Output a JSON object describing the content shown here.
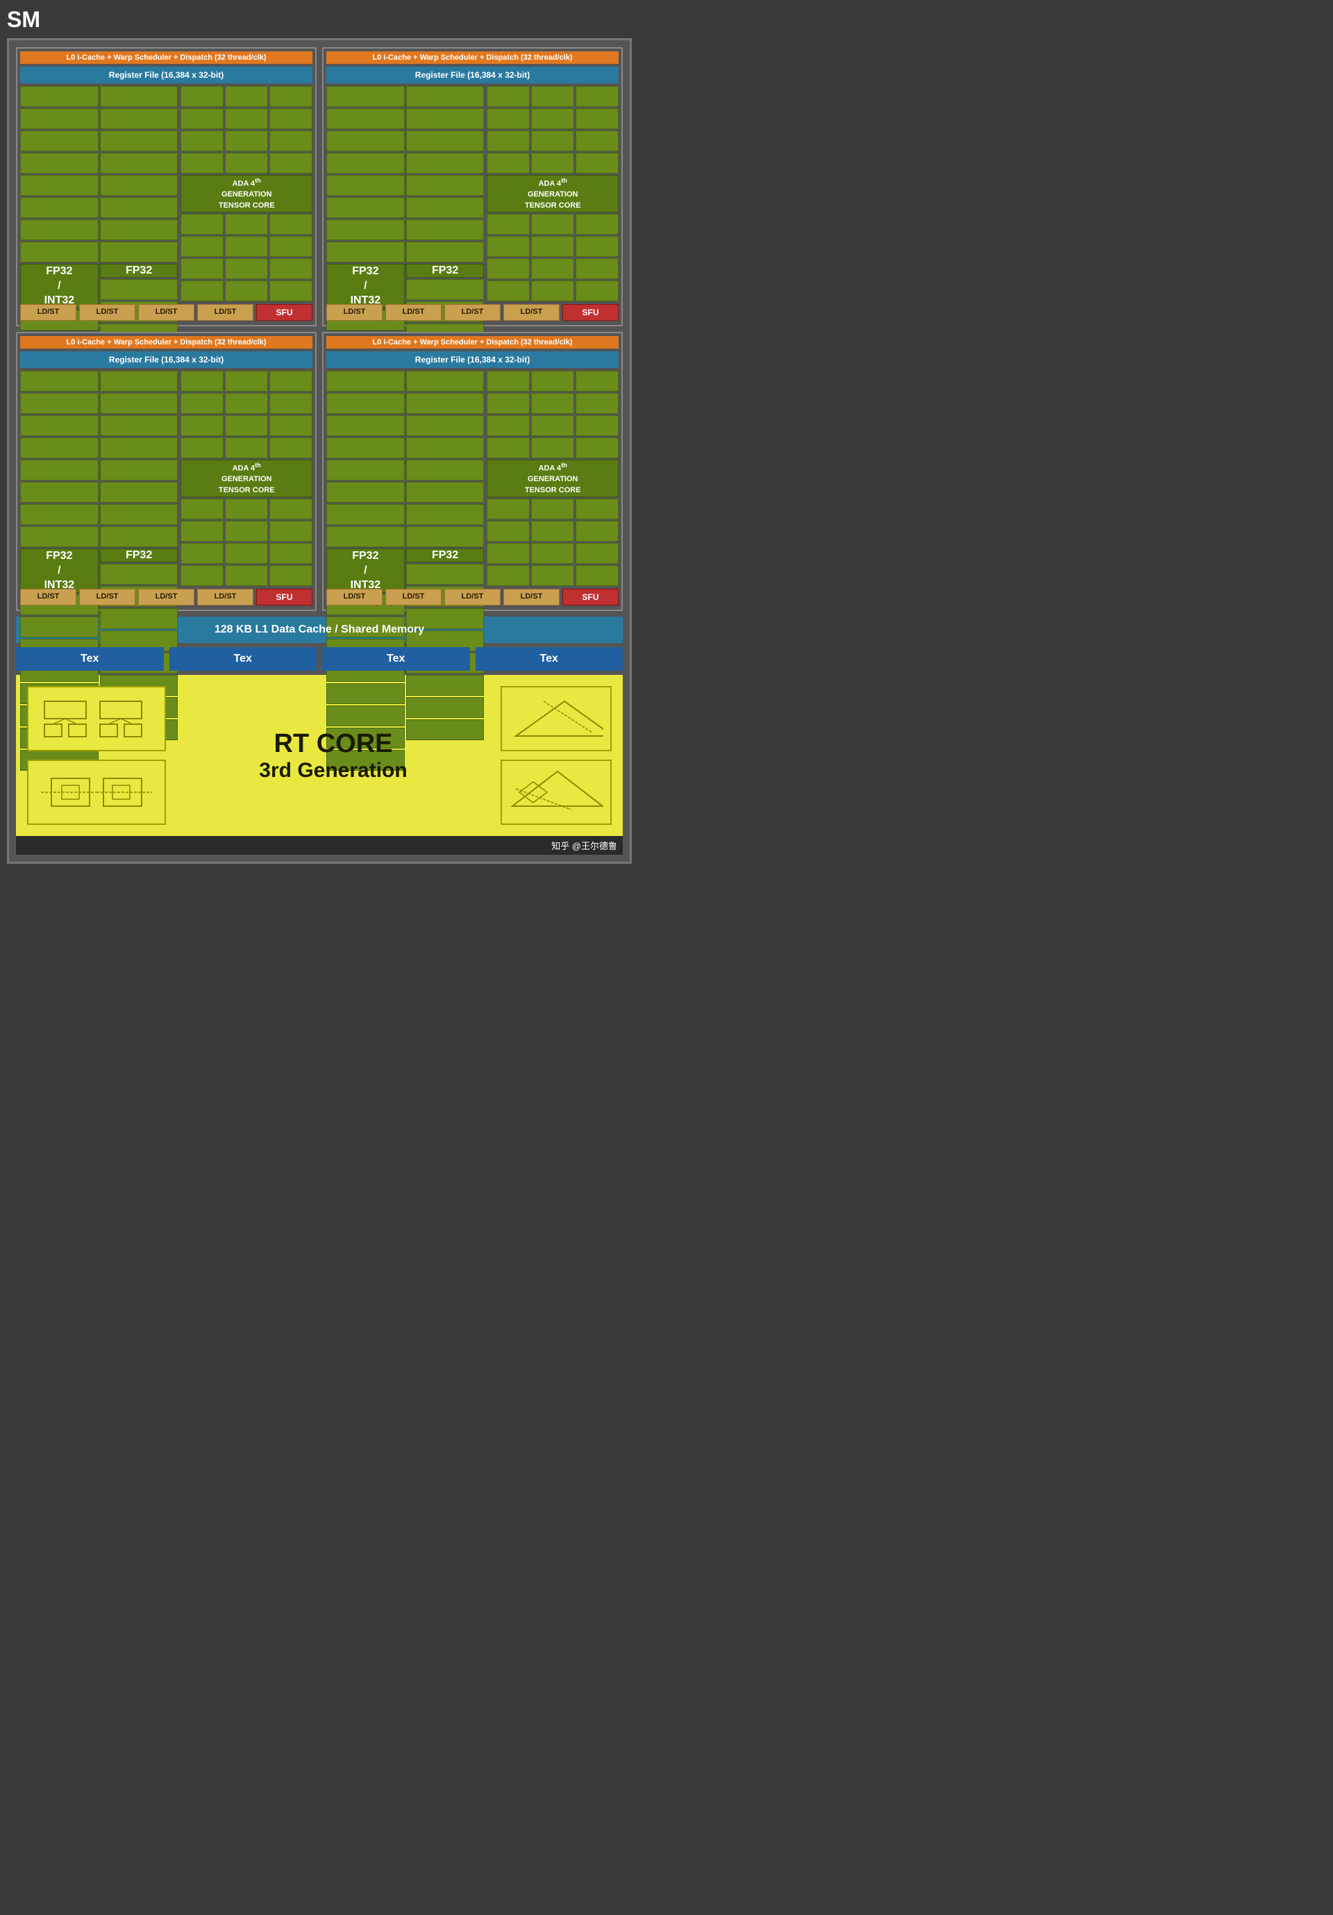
{
  "title": "SM",
  "quadrants": [
    {
      "id": "q1",
      "warp_label": "L0 i-Cache + Warp Scheduler + Dispatch (32 thread/clk)",
      "reg_label": "Register File (16,384 x 32-bit)",
      "fp32_int32_label": "FP32\n/\nINT32",
      "fp32_label": "FP32",
      "tensor_label": "ADA 4th GENERATION TENSOR CORE",
      "ldst_labels": [
        "LD/ST",
        "LD/ST",
        "LD/ST",
        "LD/ST"
      ],
      "sfu_label": "SFU"
    },
    {
      "id": "q2",
      "warp_label": "L0 i-Cache + Warp Scheduler + Dispatch (32 thread/clk)",
      "reg_label": "Register File (16,384 x 32-bit)",
      "fp32_int32_label": "FP32\n/\nINT32",
      "fp32_label": "FP32",
      "tensor_label": "ADA 4th GENERATION TENSOR CORE",
      "ldst_labels": [
        "LD/ST",
        "LD/ST",
        "LD/ST",
        "LD/ST"
      ],
      "sfu_label": "SFU"
    },
    {
      "id": "q3",
      "warp_label": "L0 i-Cache + Warp Scheduler + Dispatch (32 thread/clk)",
      "reg_label": "Register File (16,384 x 32-bit)",
      "fp32_int32_label": "FP32\n/\nINT32",
      "fp32_label": "FP32",
      "tensor_label": "ADA 4th GENERATION TENSOR CORE",
      "ldst_labels": [
        "LD/ST",
        "LD/ST",
        "LD/ST",
        "LD/ST"
      ],
      "sfu_label": "SFU"
    },
    {
      "id": "q4",
      "warp_label": "L0 i-Cache + Warp Scheduler + Dispatch (32 thread/clk)",
      "reg_label": "Register File (16,384 x 32-bit)",
      "fp32_int32_label": "FP32\n/\nINT32",
      "fp32_label": "FP32",
      "tensor_label": "ADA 4th GENERATION TENSOR CORE",
      "ldst_labels": [
        "LD/ST",
        "LD/ST",
        "LD/ST",
        "LD/ST"
      ],
      "sfu_label": "SFU"
    }
  ],
  "l1_cache_label": "128 KB L1 Data Cache / Shared Memory",
  "tex_labels": [
    "Tex",
    "Tex",
    "Tex",
    "Tex"
  ],
  "rt_core_label": "RT CORE",
  "rt_gen_label": "3rd Generation",
  "watermark": "知乎 @王尔德鲁"
}
